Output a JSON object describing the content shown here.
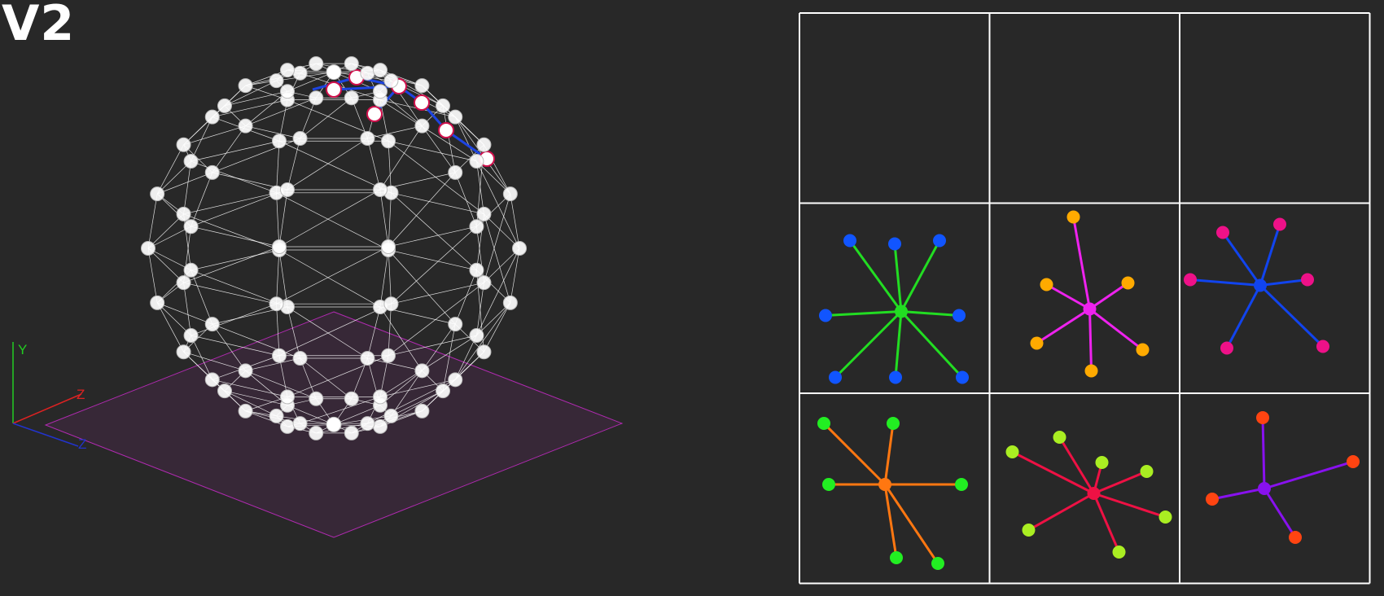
{
  "title": "V2",
  "axes": {
    "y_label": "Y",
    "z_label": "Z",
    "x_label": "Z",
    "y_color": "#22cc22",
    "z_color": "#dd2222",
    "x_color": "#2233cc"
  },
  "scene": {
    "node_color": "#ffffff",
    "wire_color": "#ffffff",
    "selected_outline_color": "#d0104c",
    "selected_path_color": "#1d44e0",
    "ground_plane_color": "#b02ab0"
  },
  "star_grid": {
    "rows": 3,
    "cols": 3,
    "border_color": "#ffffff",
    "cells": [
      {
        "empty": true
      },
      {
        "empty": true
      },
      {
        "empty": true
      },
      {
        "hub_color": "#22dd22",
        "edge_color": "#22dd22",
        "leaf_color": "#1155ff",
        "leaves": 8
      },
      {
        "hub_color": "#ee22ee",
        "edge_color": "#ee22ee",
        "leaf_color": "#ffaa00",
        "leaves": 6
      },
      {
        "hub_color": "#1144ee",
        "edge_color": "#1144ee",
        "leaf_color": "#ee1188",
        "leaves": 6
      },
      {
        "hub_color": "#ff7711",
        "edge_color": "#ff7711",
        "leaf_color": "#22ee22",
        "leaves": 6
      },
      {
        "hub_color": "#ee1144",
        "edge_color": "#ee1144",
        "leaf_color": "#aaee22",
        "leaves": 7
      },
      {
        "hub_color": "#8811ee",
        "edge_color": "#8811ee",
        "leaf_color": "#ff4411",
        "leaves": 4
      }
    ]
  }
}
